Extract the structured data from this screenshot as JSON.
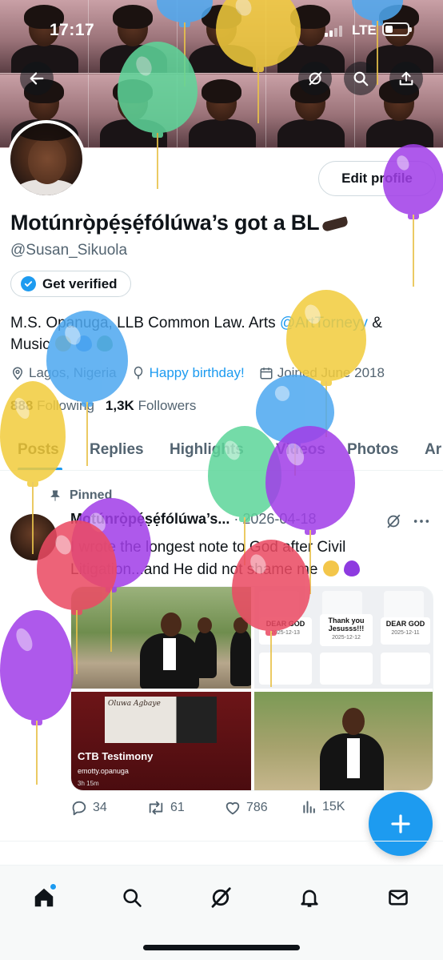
{
  "status_bar": {
    "time": "17:17",
    "network": "LTE"
  },
  "profile": {
    "display_name": "Motúnrọ̀pẹ́ṣẹ́fólúwa’s got a BL",
    "handle": "@Susan_Sikuola",
    "edit_button": "Edit profile",
    "verified_button": "Get verified",
    "bio_text": "M.S. Opanuga, LLB Common Law. Arts ",
    "bio_mention": "@ArtTorneyy",
    "bio_after_mention": " &",
    "bio_line2": "Music",
    "location": "Lagos, Nigeria",
    "birthday": "Happy birthday!",
    "joined": "Joined June 2018",
    "following_count": "888",
    "following_label": "Following",
    "followers_count": "1,3K",
    "followers_label": "Followers"
  },
  "tabs": [
    "Posts",
    "Replies",
    "Highlights",
    "Videos",
    "Photos",
    "Ar"
  ],
  "pinned_post": {
    "pinned_label": "Pinned",
    "author": "Motúnrọ̀pẹ́ṣẹ́fólúwa’s...",
    "separator": "·",
    "date": "2026-04-18",
    "text": "I wrote the longest note to God after Civil Litigation...and He did not shame me",
    "media": {
      "cards": [
        {
          "title": "DEAR GOD",
          "date": "2025-12-13"
        },
        {
          "title": "Thank you Jesusss!!!",
          "date": "2025-12-12"
        },
        {
          "title": "DEAR GOD",
          "date": "2025-12-11"
        }
      ],
      "poster_text": "Oluwa Agbaye",
      "video_title": "CTB Testimony",
      "video_user": "emotty.opanuga",
      "video_time": "3h 15m"
    },
    "reply_count": "34",
    "repost_count": "61",
    "like_count": "786",
    "view_count": "15K"
  },
  "colors": {
    "accent": "#1d9bf0",
    "text": "#0f1419",
    "secondary_text": "#536471",
    "balloon_green": "#5ed69a",
    "balloon_yellow": "#f2cc3d",
    "balloon_purple": "#a13ee8",
    "balloon_blue": "#4ea8f0",
    "balloon_red": "#eb4a63"
  },
  "icons": [
    "back-arrow-icon",
    "grok-icon",
    "search-icon",
    "share-icon",
    "verified-badge-icon",
    "location-pin-icon",
    "balloon-icon",
    "calendar-icon",
    "pin-icon",
    "reply-icon",
    "repost-icon",
    "like-icon",
    "views-icon",
    "compose-plus-icon",
    "home-icon",
    "notifications-bell-icon",
    "messages-envelope-icon"
  ]
}
